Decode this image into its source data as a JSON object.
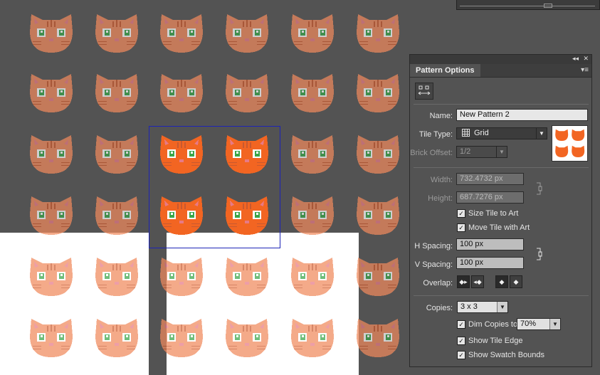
{
  "panel": {
    "title": "Pattern Options",
    "collapse_glyph": "◂◂",
    "close_glyph": "✕",
    "menu_glyph": "▾≡",
    "name_label": "Name:",
    "name_value": "New Pattern 2",
    "tile_type_label": "Tile Type:",
    "tile_type_value": "Grid",
    "brick_offset_label": "Brick Offset:",
    "brick_offset_value": "1/2",
    "width_label": "Width:",
    "width_value": "732.4732 px",
    "height_label": "Height:",
    "height_value": "687.7276 px",
    "size_tile_label": "Size Tile to Art",
    "size_tile_checked": true,
    "move_tile_label": "Move Tile with Art",
    "move_tile_checked": true,
    "h_spacing_label": "H Spacing:",
    "h_spacing_value": "100 px",
    "v_spacing_label": "V Spacing:",
    "v_spacing_value": "100 px",
    "overlap_label": "Overlap:",
    "copies_label": "Copies:",
    "copies_value": "3 x 3",
    "dim_copies_label": "Dim Copies to:",
    "dim_copies_checked": true,
    "dim_copies_value": "70%",
    "show_tile_edge_label": "Show Tile Edge",
    "show_tile_edge_checked": true,
    "show_swatch_bounds_label": "Show Swatch Bounds",
    "show_swatch_bounds_checked": true,
    "check_glyph": "✓",
    "dropdown_arrow": "▼"
  },
  "colors": {
    "canvas_bg": "#535353",
    "cat_dim": "#f08a5d",
    "cat_active": "#f26522",
    "cat_stripe": "#c9592f",
    "cat_eye_iris": "#3aa64a",
    "cat_nose": "#e77a86",
    "tile_edge": "#1d24b6"
  },
  "icons": [
    "grid-icon",
    "link-icon",
    "fit-tile-icon",
    "cat-icon"
  ]
}
